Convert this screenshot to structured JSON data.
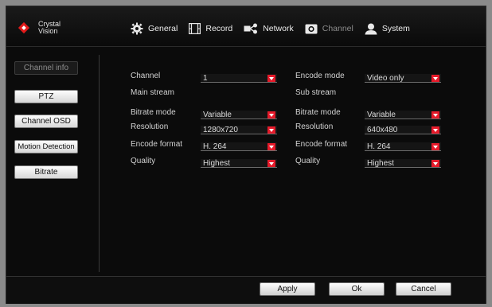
{
  "logo": {
    "line1": "Crystal",
    "line2": "Vision"
  },
  "menu": {
    "general": "General",
    "record": "Record",
    "network": "Network",
    "channel": "Channel",
    "system": "System"
  },
  "sidebar": {
    "items": [
      {
        "label": "Channel info",
        "active": true
      },
      {
        "label": "PTZ"
      },
      {
        "label": "Channel OSD"
      },
      {
        "label": "Motion Detection"
      },
      {
        "label": "Bitrate"
      }
    ]
  },
  "form": {
    "channel_label": "Channel",
    "channel_value": "1",
    "encode_mode_label": "Encode mode",
    "encode_mode_value": "Video only",
    "main_stream_label": "Main stream",
    "sub_stream_label": "Sub stream",
    "main": {
      "bitrate_mode_label": "Bitrate mode",
      "bitrate_mode_value": "Variable",
      "resolution_label": "Resolution",
      "resolution_value": "1280x720",
      "encode_format_label": "Encode format",
      "encode_format_value": "H. 264",
      "quality_label": "Quality",
      "quality_value": "Highest"
    },
    "sub": {
      "bitrate_mode_label": "Bitrate mode",
      "bitrate_mode_value": "Variable",
      "resolution_label": "Resolution",
      "resolution_value": "640x480",
      "encode_format_label": "Encode format",
      "encode_format_value": "H. 264",
      "quality_label": "Quality",
      "quality_value": "Highest"
    }
  },
  "footer": {
    "apply": "Apply",
    "ok": "Ok",
    "cancel": "Cancel"
  },
  "colors": {
    "accent": "#e51a2a",
    "background": "#0b0b0b"
  }
}
